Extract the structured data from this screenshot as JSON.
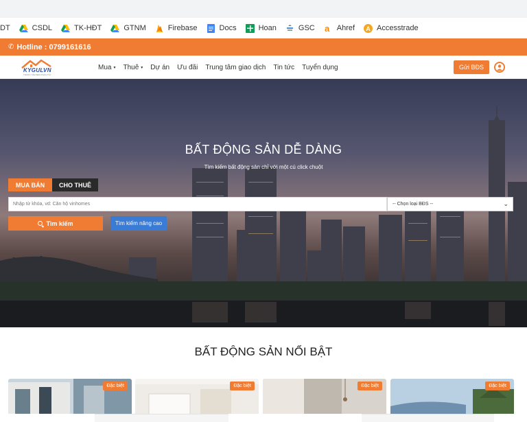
{
  "bookmarks": [
    {
      "label": "DT",
      "icon": "none"
    },
    {
      "label": "CSDL",
      "icon": "google-drive-icon"
    },
    {
      "label": "TK-HĐT",
      "icon": "google-drive-icon"
    },
    {
      "label": "GTNM",
      "icon": "google-drive-icon"
    },
    {
      "label": "Firebase",
      "icon": "firebase-icon"
    },
    {
      "label": "Docs",
      "icon": "google-docs-icon"
    },
    {
      "label": "Hoan",
      "icon": "google-sheets-icon"
    },
    {
      "label": "GSC",
      "icon": "search-console-icon"
    },
    {
      "label": "Ahref",
      "icon": "ahrefs-icon"
    },
    {
      "label": "Accesstrade",
      "icon": "accesstrade-icon"
    }
  ],
  "hotline": {
    "text": "Hotline : 0799161616"
  },
  "logo": {
    "text": "KYGULVN",
    "sub": "TRUNG TÂM BĐS PHÚC TÂY"
  },
  "nav": {
    "items": [
      {
        "label": "Mua",
        "caret": "▾"
      },
      {
        "label": "Thuê",
        "caret": "▾"
      },
      {
        "label": "Dự án",
        "caret": ""
      },
      {
        "label": "Ưu đãi",
        "caret": ""
      },
      {
        "label": "Trung tâm giao dịch",
        "caret": ""
      },
      {
        "label": "Tin tức",
        "caret": ""
      },
      {
        "label": "Tuyển dụng",
        "caret": ""
      }
    ],
    "send_button": "Gửi BĐS"
  },
  "hero": {
    "title": "BẤT ĐỘNG SẢN DỄ DÀNG",
    "subtitle": "Tìm kiếm bất động sản chỉ với một cú click chuột",
    "tab_sale": "MUA BÁN",
    "tab_rent": "CHO THUÊ",
    "search_placeholder": "Nhập từ khóa, vd: Căn hộ vinhomes",
    "type_select_value": "-- Chọn loại BĐS --",
    "search_button": "Tìm kiếm",
    "advanced_button": "Tìm kiếm nâng cao"
  },
  "featured": {
    "title": "BẤT ĐỘNG SẢN NỔI BẬT",
    "cards": [
      {
        "badge": "Đặc biệt"
      },
      {
        "badge": "Đặc biệt"
      },
      {
        "badge": "Đặc biệt"
      },
      {
        "badge": "Đặc biệt"
      }
    ]
  },
  "colors": {
    "accent": "#f07c33",
    "secondary": "#3a7bd5",
    "dark": "#2a2a2a"
  }
}
